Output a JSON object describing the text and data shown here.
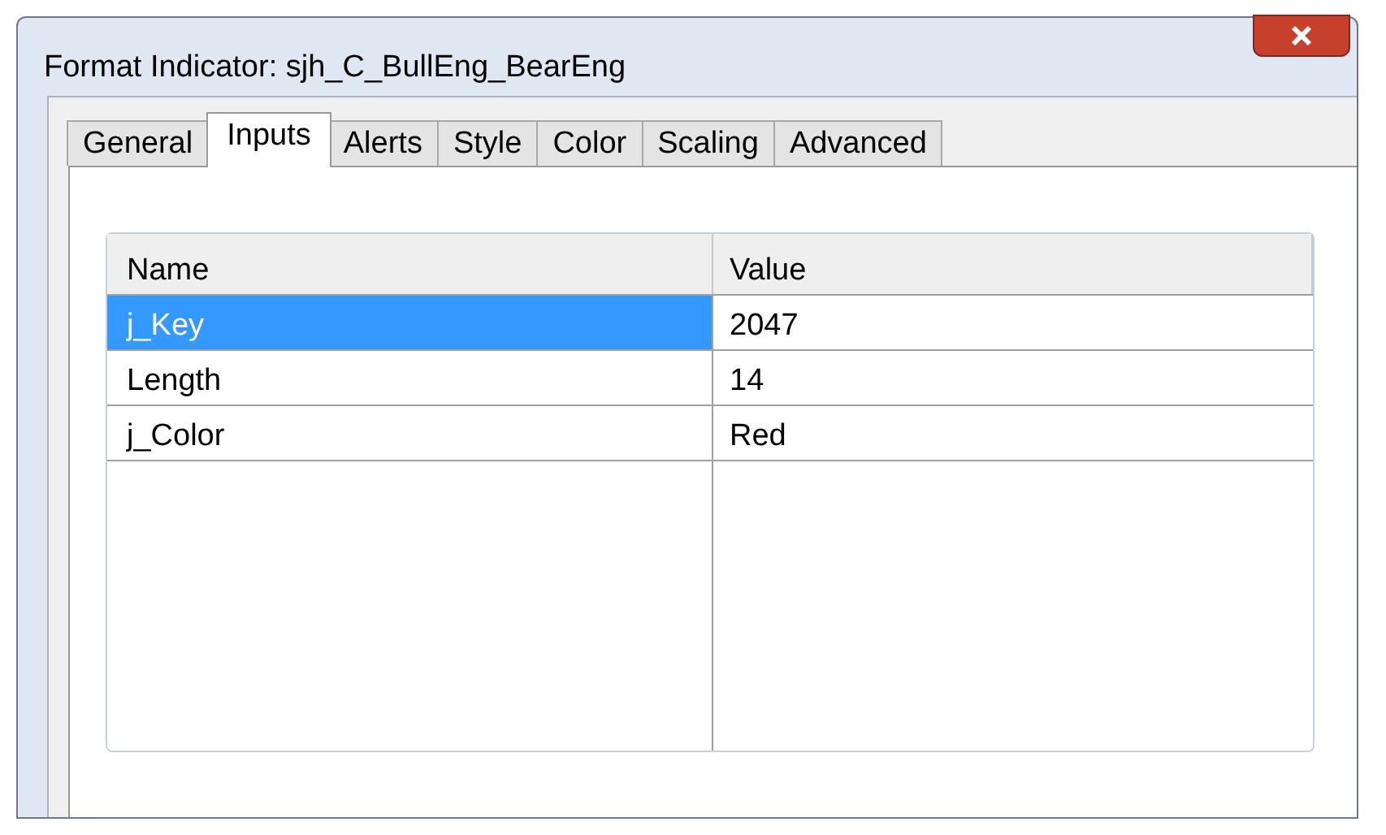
{
  "window": {
    "title": "Format Indicator: sjh_C_BullEng_BearEng"
  },
  "tabs": [
    {
      "label": "General",
      "selected": false
    },
    {
      "label": "Inputs",
      "selected": true
    },
    {
      "label": "Alerts",
      "selected": false
    },
    {
      "label": "Style",
      "selected": false
    },
    {
      "label": "Color",
      "selected": false
    },
    {
      "label": "Scaling",
      "selected": false
    },
    {
      "label": "Advanced",
      "selected": false
    }
  ],
  "table": {
    "columns": [
      "Name",
      "Value"
    ],
    "rows": [
      {
        "name": "j_Key",
        "value": "2047",
        "selected": true
      },
      {
        "name": "Length",
        "value": "14",
        "selected": false
      },
      {
        "name": "j_Color",
        "value": "Red",
        "selected": false
      }
    ]
  }
}
